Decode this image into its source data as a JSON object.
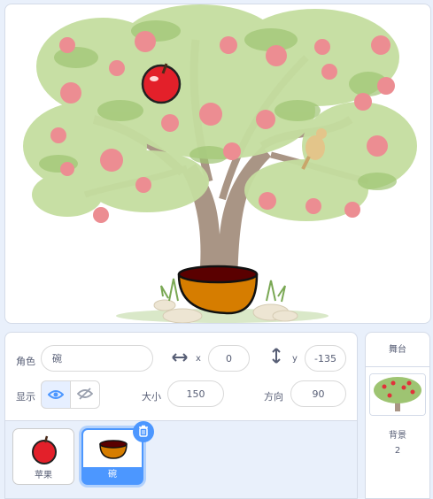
{
  "sprite_panel": {
    "sprite_label": "角色",
    "sprite_name": "碗",
    "x_label": "x",
    "x_value": "0",
    "y_label": "y",
    "y_value": "-135",
    "show_label": "显示",
    "size_label": "大小",
    "size_value": "150",
    "direction_label": "方向",
    "direction_value": "90"
  },
  "sprites": [
    {
      "name": "苹果"
    },
    {
      "name": "碗"
    }
  ],
  "stage_panel": {
    "title": "舞台",
    "backdrops_label": "背景",
    "backdrops_count": "2"
  },
  "colors": {
    "accent": "#4c97ff",
    "text": "#575e75"
  }
}
